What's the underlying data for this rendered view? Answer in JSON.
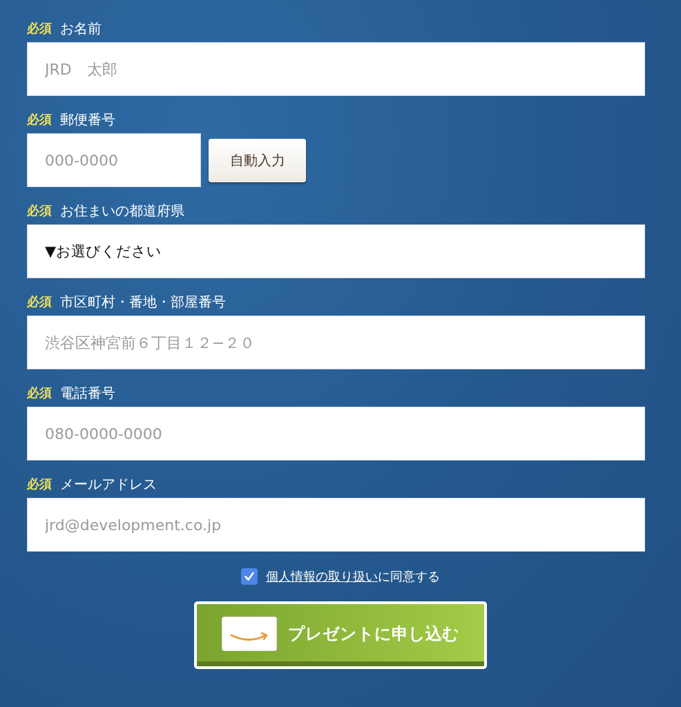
{
  "fields": [
    {
      "kind": "text",
      "badge": "必須",
      "label": "お名前",
      "placeholder": "JRD　太郎"
    },
    {
      "kind": "zip",
      "badge": "必須",
      "label": "郵便番号",
      "placeholder": "000-0000",
      "button": "自動入力"
    },
    {
      "kind": "select",
      "badge": "必須",
      "label": "お住まいの都道府県",
      "value": "▼お選びください"
    },
    {
      "kind": "text",
      "badge": "必須",
      "label": "市区町村・番地・部屋番号",
      "placeholder": "渋谷区神宮前６丁目１２−２０"
    },
    {
      "kind": "text",
      "badge": "必須",
      "label": "電話番号",
      "placeholder": "080-0000-0000"
    },
    {
      "kind": "text",
      "badge": "必須",
      "label": "メールアドレス",
      "placeholder": "jrd@development.co.jp"
    }
  ],
  "consent": {
    "checked": true,
    "link": "個人情報の取り扱い",
    "text": "に同意する"
  },
  "submit": {
    "label": "プレゼントに申し込む"
  }
}
